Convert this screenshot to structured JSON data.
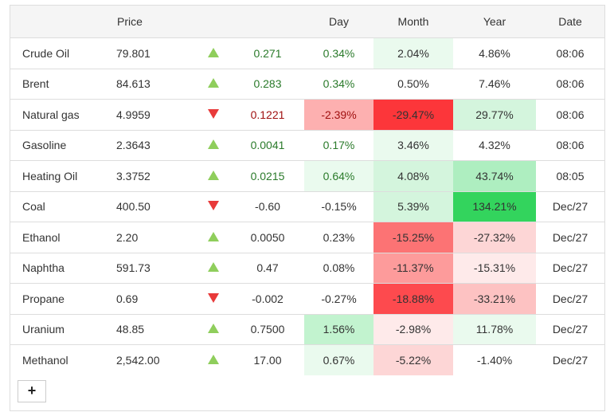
{
  "headers": {
    "name": "",
    "price": "Price",
    "arrow": "",
    "change": "",
    "day": "Day",
    "month": "Month",
    "year": "Year",
    "date": "Date"
  },
  "add_button": "+",
  "rows": [
    {
      "name": "Crude Oil",
      "price": "79.801",
      "dir": "up",
      "change": "0.271",
      "change_color": "#2a7a2a",
      "day": "0.34%",
      "day_color": "#2a7a2a",
      "day_bg": "#fff",
      "month": "2.04%",
      "month_bg": "#eafaee",
      "year": "4.86%",
      "year_bg": "#fff",
      "date": "08:06"
    },
    {
      "name": "Brent",
      "price": "84.613",
      "dir": "up",
      "change": "0.283",
      "change_color": "#2a7a2a",
      "day": "0.34%",
      "day_color": "#2a7a2a",
      "day_bg": "#fff",
      "month": "0.50%",
      "month_bg": "#fff",
      "year": "7.46%",
      "year_bg": "#fff",
      "date": "08:06"
    },
    {
      "name": "Natural gas",
      "price": "4.9959",
      "dir": "down",
      "change": "0.1221",
      "change_color": "#a01010",
      "day": "-2.39%",
      "day_color": "#a01010",
      "day_bg": "#fdb0b0",
      "month": "-29.47%",
      "month_bg": "#fc363a",
      "year": "29.77%",
      "year_bg": "#d4f5dd",
      "date": "08:06"
    },
    {
      "name": "Gasoline",
      "price": "2.3643",
      "dir": "up",
      "change": "0.0041",
      "change_color": "#2a7a2a",
      "day": "0.17%",
      "day_color": "#2a7a2a",
      "day_bg": "#fff",
      "month": "3.46%",
      "month_bg": "#eafaee",
      "year": "4.32%",
      "year_bg": "#fff",
      "date": "08:06"
    },
    {
      "name": "Heating Oil",
      "price": "3.3752",
      "dir": "up",
      "change": "0.0215",
      "change_color": "#2a7a2a",
      "day": "0.64%",
      "day_color": "#2a7a2a",
      "day_bg": "#eafaee",
      "month": "4.08%",
      "month_bg": "#d4f5dd",
      "year": "43.74%",
      "year_bg": "#aeeec0",
      "date": "08:05"
    },
    {
      "name": "Coal",
      "price": "400.50",
      "dir": "down",
      "change": "-0.60",
      "change_color": "#333",
      "day": "-0.15%",
      "day_color": "#333",
      "day_bg": "#fff",
      "month": "5.39%",
      "month_bg": "#d4f5dd",
      "year": "134.21%",
      "year_bg": "#33d45d",
      "date": "Dec/27"
    },
    {
      "name": "Ethanol",
      "price": "2.20",
      "dir": "up",
      "change": "0.0050",
      "change_color": "#333",
      "day": "0.23%",
      "day_color": "#333",
      "day_bg": "#fff",
      "month": "-15.25%",
      "month_bg": "#fc7374",
      "year": "-27.32%",
      "year_bg": "#fdd6d6",
      "date": "Dec/27"
    },
    {
      "name": "Naphtha",
      "price": "591.73",
      "dir": "up",
      "change": "0.47",
      "change_color": "#333",
      "day": "0.08%",
      "day_color": "#333",
      "day_bg": "#fff",
      "month": "-11.37%",
      "month_bg": "#fd9b9b",
      "year": "-15.31%",
      "year_bg": "#feeaea",
      "date": "Dec/27"
    },
    {
      "name": "Propane",
      "price": "0.69",
      "dir": "down",
      "change": "-0.002",
      "change_color": "#333",
      "day": "-0.27%",
      "day_color": "#333",
      "day_bg": "#fff",
      "month": "-18.88%",
      "month_bg": "#fd4a4e",
      "year": "-33.21%",
      "year_bg": "#fdc2c2",
      "date": "Dec/27"
    },
    {
      "name": "Uranium",
      "price": "48.85",
      "dir": "up",
      "change": "0.7500",
      "change_color": "#333",
      "day": "1.56%",
      "day_color": "#333",
      "day_bg": "#c2f3cf",
      "month": "-2.98%",
      "month_bg": "#feeaea",
      "year": "11.78%",
      "year_bg": "#eafaee",
      "date": "Dec/27"
    },
    {
      "name": "Methanol",
      "price": "2,542.00",
      "dir": "up",
      "change": "17.00",
      "change_color": "#333",
      "day": "0.67%",
      "day_color": "#333",
      "day_bg": "#eafaee",
      "month": "-5.22%",
      "month_bg": "#fdd6d6",
      "year": "-1.40%",
      "year_bg": "#fff",
      "date": "Dec/27"
    }
  ]
}
